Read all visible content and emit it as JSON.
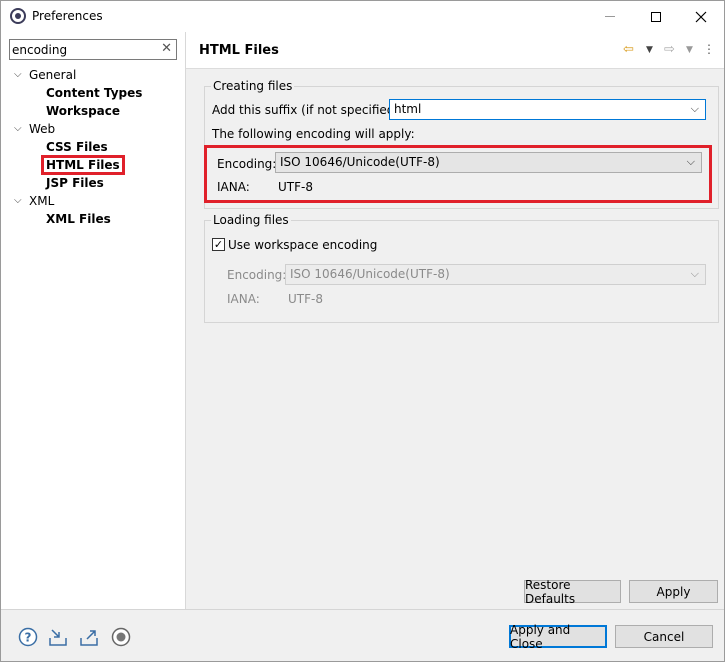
{
  "window": {
    "title": "Preferences"
  },
  "filter": {
    "value": "encoding"
  },
  "tree": {
    "general": "General",
    "content_types": "Content Types",
    "workspace": "Workspace",
    "web": "Web",
    "css_files": "CSS Files",
    "html_files": "HTML Files",
    "jsp_files": "JSP Files",
    "xml": "XML",
    "xml_files": "XML Files"
  },
  "page": {
    "title": "HTML Files",
    "creating": {
      "group_title": "Creating files",
      "suffix_label": "Add this suffix (if not specified):",
      "suffix_value": "html",
      "apply_text": "The following encoding will apply:",
      "encoding_label": "Encoding:",
      "encoding_value": "ISO 10646/Unicode(UTF-8)",
      "iana_label": "IANA:",
      "iana_value": "UTF-8"
    },
    "loading": {
      "group_title": "Loading files",
      "use_workspace_label": "Use workspace encoding",
      "use_workspace_checked": true,
      "encoding_label": "Encoding:",
      "encoding_value": "ISO 10646/Unicode(UTF-8)",
      "iana_label": "IANA:",
      "iana_value": "UTF-8"
    },
    "restore_defaults": "Restore Defaults",
    "apply": "Apply"
  },
  "footer": {
    "apply_and_close": "Apply and Close",
    "cancel": "Cancel"
  },
  "colors": {
    "highlight": "#e0202a",
    "accent": "#0078d7"
  }
}
